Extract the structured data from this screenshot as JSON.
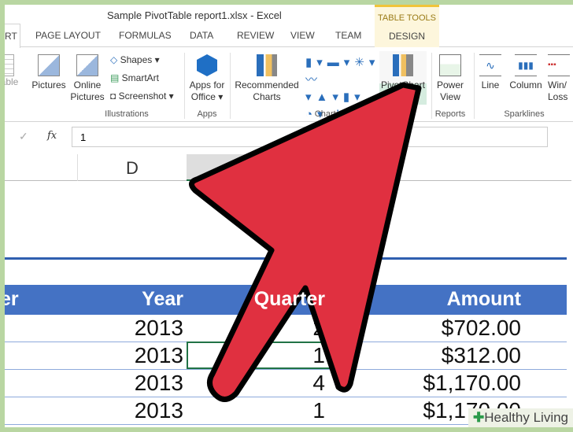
{
  "window": {
    "title": "Sample PivotTable report1.xlsx - Excel"
  },
  "tabs": [
    "RT",
    "PAGE LAYOUT",
    "FORMULAS",
    "DATA",
    "REVIEW",
    "VIEW",
    "TEAM"
  ],
  "context_tab": {
    "group": "TABLE TOOLS",
    "label": "DESIGN"
  },
  "ribbon": {
    "table_label": "able",
    "pictures": "Pictures",
    "online_pictures": "Online Pictures",
    "shapes": "Shapes ▾",
    "smartart": "SmartArt",
    "screenshot": "Screenshot ▾",
    "illustrations": "Illustrations",
    "apps_for_office": "Apps for Office ▾",
    "apps": "Apps",
    "recommended_charts": "Recommended Charts",
    "charts": "Charts",
    "pivotchart": "PivotChart",
    "power_view": "Power View",
    "reports": "Reports",
    "line": "Line",
    "column": "Column",
    "winloss": "Win/ Loss",
    "sparklines": "Sparklines"
  },
  "formula_bar": {
    "fx": "fx",
    "value": "1"
  },
  "column_header": "D",
  "table": {
    "headers": [
      "er",
      "Year",
      "Quarter",
      "Amount"
    ],
    "rows": [
      [
        "2013",
        "2",
        "$702.00"
      ],
      [
        "2013",
        "1",
        "$312.00"
      ],
      [
        "2013",
        "4",
        "$1,170.00"
      ],
      [
        "2013",
        "1",
        "$1,170.00"
      ]
    ]
  },
  "watermark": "Healthy Living",
  "colors": {
    "header_blue": "#4472c4",
    "arrow_red": "#e03040"
  }
}
